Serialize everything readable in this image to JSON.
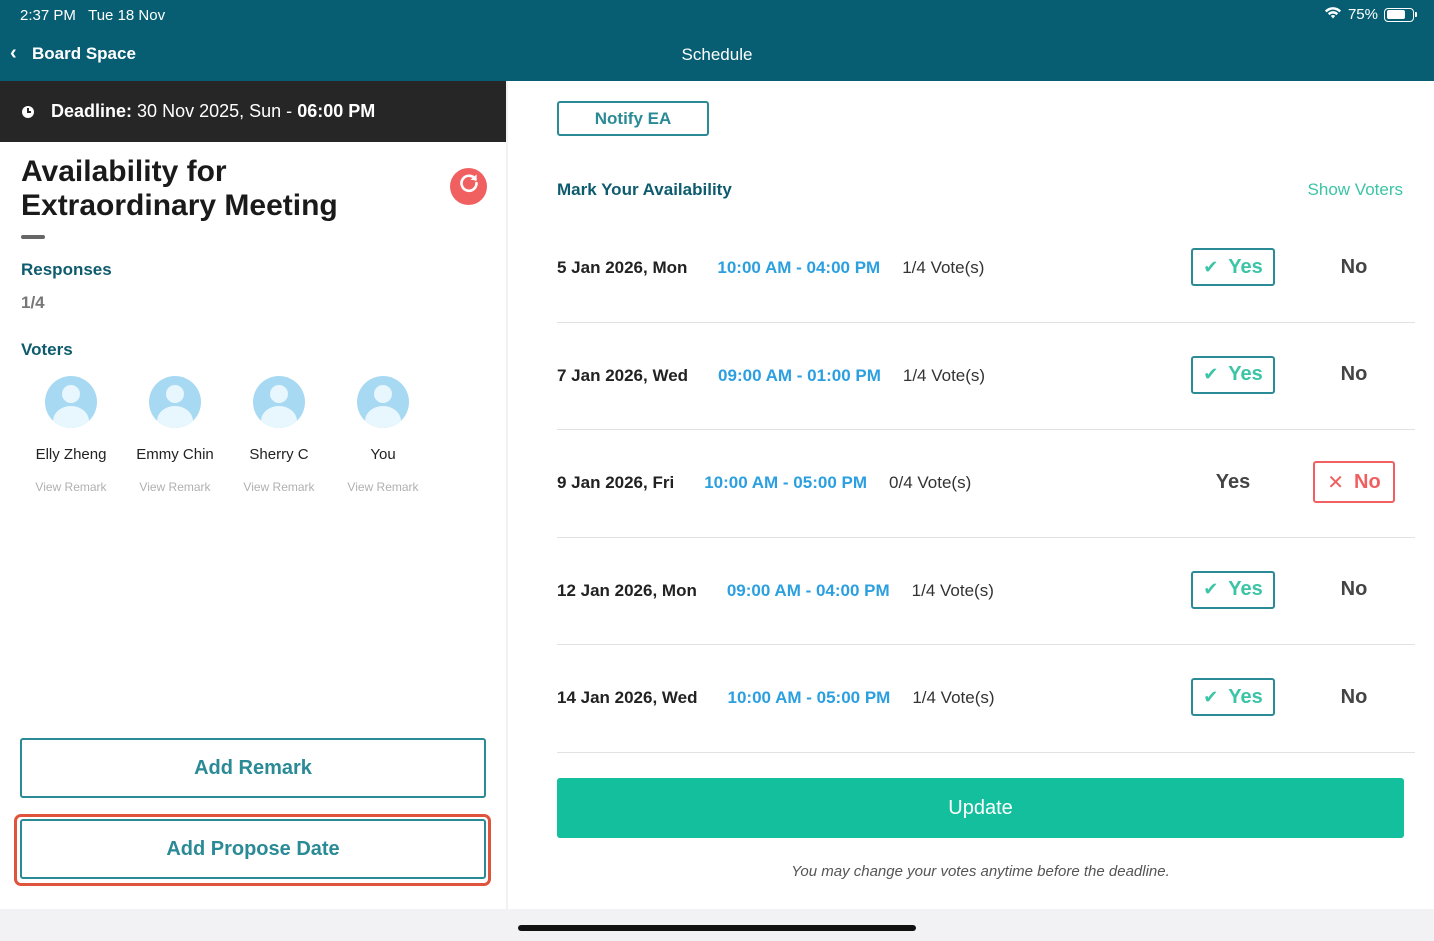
{
  "status": {
    "time": "2:37 PM",
    "date": "Tue 18 Nov",
    "battery": "75%",
    "battery_level": 0.75
  },
  "nav": {
    "back_label": "Board Space",
    "title": "Schedule"
  },
  "deadline": {
    "label": "Deadline:",
    "date": "30 Nov 2025, Sun",
    "sep": "-",
    "time": "06:00 PM"
  },
  "meeting": {
    "title": "Availability for Extraordinary Meeting"
  },
  "responses": {
    "label": "Responses",
    "value": "1/4"
  },
  "voters": {
    "label": "Voters",
    "items": [
      {
        "name": "Elly Zheng",
        "remark": "View Remark"
      },
      {
        "name": "Emmy Chin",
        "remark": "View Remark"
      },
      {
        "name": "Sherry C",
        "remark": "View Remark"
      },
      {
        "name": "You",
        "remark": "View Remark"
      }
    ]
  },
  "actions": {
    "add_remark": "Add Remark",
    "add_propose_date": "Add Propose Date"
  },
  "right": {
    "notify_label": "Notify EA",
    "mark_label": "Mark Your Availability",
    "show_voters": "Show Voters",
    "yes_label": "Yes",
    "no_label": "No",
    "update_label": "Update",
    "note": "You may change your votes anytime before the deadline."
  },
  "slots": [
    {
      "date": "5 Jan 2026, Mon",
      "time": "10:00 AM - 04:00 PM",
      "votes": "1/4 Vote(s)",
      "choice": "yes"
    },
    {
      "date": "7 Jan 2026, Wed",
      "time": "09:00 AM - 01:00 PM",
      "votes": "1/4 Vote(s)",
      "choice": "yes"
    },
    {
      "date": "9 Jan 2026, Fri",
      "time": "10:00 AM - 05:00 PM",
      "votes": "0/4 Vote(s)",
      "choice": "no"
    },
    {
      "date": "12 Jan 2026, Mon",
      "time": "09:00 AM - 04:00 PM",
      "votes": "1/4 Vote(s)",
      "choice": "yes"
    },
    {
      "date": "14 Jan 2026, Wed",
      "time": "10:00 AM - 05:00 PM",
      "votes": "1/4 Vote(s)",
      "choice": "yes"
    }
  ],
  "colors": {
    "header": "#075e72",
    "accent": "#2a8a96",
    "green": "#14bf9d",
    "red": "#f06060",
    "time_blue": "#2b9fe0"
  }
}
